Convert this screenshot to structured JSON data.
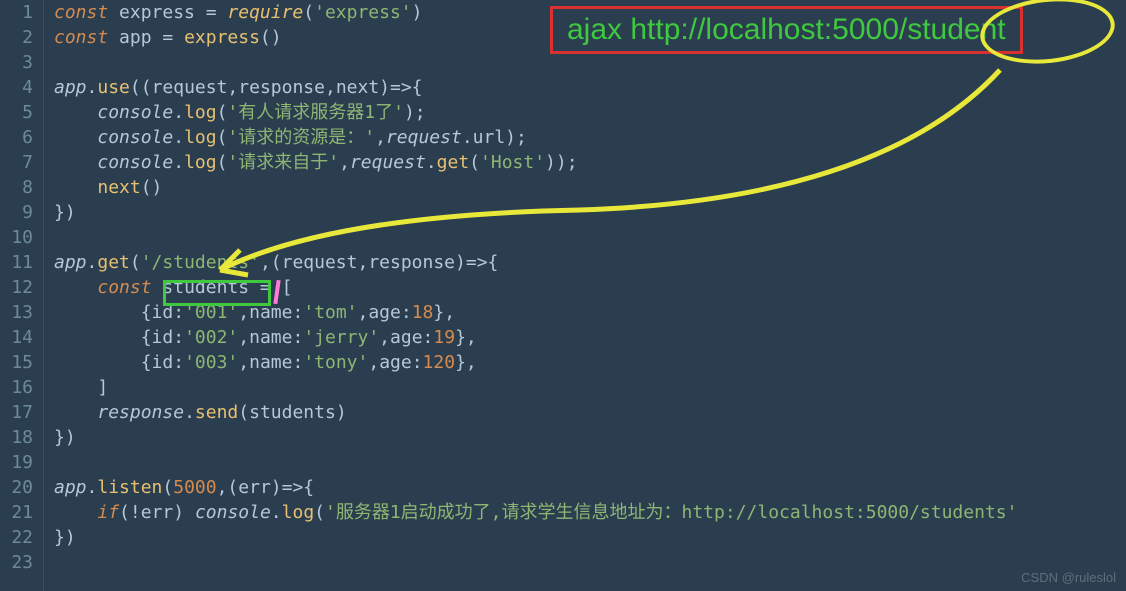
{
  "annotation": {
    "text": "ajax http://localhost:5000/student"
  },
  "highlight_route": "/students",
  "watermark": "CSDN @ruleslol",
  "lines": [
    {
      "n": "1",
      "html": "<span class='kw'>const</span> <span class='var'>express</span> = <span class='fn'>require</span>(<span class='str'>'express'</span>)"
    },
    {
      "n": "2",
      "html": "<span class='kw'>const</span> <span class='var'>app</span> = <span class='call'>express</span>()"
    },
    {
      "n": "3",
      "html": ""
    },
    {
      "n": "4",
      "html": "<span class='obj'>app</span>.<span class='method'>use</span>((<span class='param'>request</span>,<span class='param'>response</span>,<span class='param'>next</span>)=&gt;{"
    },
    {
      "n": "5",
      "html": "    <span class='obj'>console</span>.<span class='method'>log</span>(<span class='str'>'有人请求服务器1了'</span>);"
    },
    {
      "n": "6",
      "html": "    <span class='obj'>console</span>.<span class='method'>log</span>(<span class='str'>'请求的资源是：'</span>,<span class='obj'>request</span>.<span class='prop'>url</span>);"
    },
    {
      "n": "7",
      "html": "    <span class='obj'>console</span>.<span class='method'>log</span>(<span class='str'>'请求来自于'</span>,<span class='obj'>request</span>.<span class='method'>get</span>(<span class='str'>'Host'</span>));"
    },
    {
      "n": "8",
      "html": "    <span class='call'>next</span>()"
    },
    {
      "n": "9",
      "html": "})"
    },
    {
      "n": "10",
      "html": ""
    },
    {
      "n": "11",
      "html": "<span class='obj'>app</span>.<span class='method'>get</span>(<span class='str'>'/students'</span>,(<span class='param'>request</span>,<span class='param'>response</span>)=&gt;{"
    },
    {
      "n": "12",
      "html": "    <span class='kw'>const</span> <span class='var'>students</span> = ["
    },
    {
      "n": "13",
      "html": "        {<span class='prop'>id</span>:<span class='str'>'001'</span>,<span class='prop'>name</span>:<span class='str'>'tom'</span>,<span class='prop'>age</span>:<span class='num'>18</span>},"
    },
    {
      "n": "14",
      "html": "        {<span class='prop'>id</span>:<span class='str'>'002'</span>,<span class='prop'>name</span>:<span class='str'>'jerry'</span>,<span class='prop'>age</span>:<span class='num'>19</span>},"
    },
    {
      "n": "15",
      "html": "        {<span class='prop'>id</span>:<span class='str'>'003'</span>,<span class='prop'>name</span>:<span class='str'>'tony'</span>,<span class='prop'>age</span>:<span class='num'>120</span>},"
    },
    {
      "n": "16",
      "html": "    ]"
    },
    {
      "n": "17",
      "html": "    <span class='obj'>response</span>.<span class='method'>send</span>(<span class='var'>students</span>)"
    },
    {
      "n": "18",
      "html": "})"
    },
    {
      "n": "19",
      "html": ""
    },
    {
      "n": "20",
      "html": "<span class='obj'>app</span>.<span class='method'>listen</span>(<span class='num'>5000</span>,(<span class='param'>err</span>)=&gt;{"
    },
    {
      "n": "21",
      "html": "    <span class='kw'>if</span>(!<span class='var'>err</span>) <span class='obj'>console</span>.<span class='method'>log</span>(<span class='str'>'服务器1启动成功了,请求学生信息地址为：http://localhost:5000/students'</span>"
    },
    {
      "n": "22",
      "html": "})"
    },
    {
      "n": "23",
      "html": ""
    }
  ],
  "code_data": {
    "students": [
      {
        "id": "001",
        "name": "tom",
        "age": 18
      },
      {
        "id": "002",
        "name": "jerry",
        "age": 19
      },
      {
        "id": "003",
        "name": "tony",
        "age": 120
      }
    ],
    "port": 5000,
    "route": "/students",
    "server_start_msg": "服务器1启动成功了,请求学生信息地址为：http://localhost:5000/students",
    "log_msgs": [
      "有人请求服务器1了",
      "请求的资源是：",
      "请求来自于"
    ]
  }
}
